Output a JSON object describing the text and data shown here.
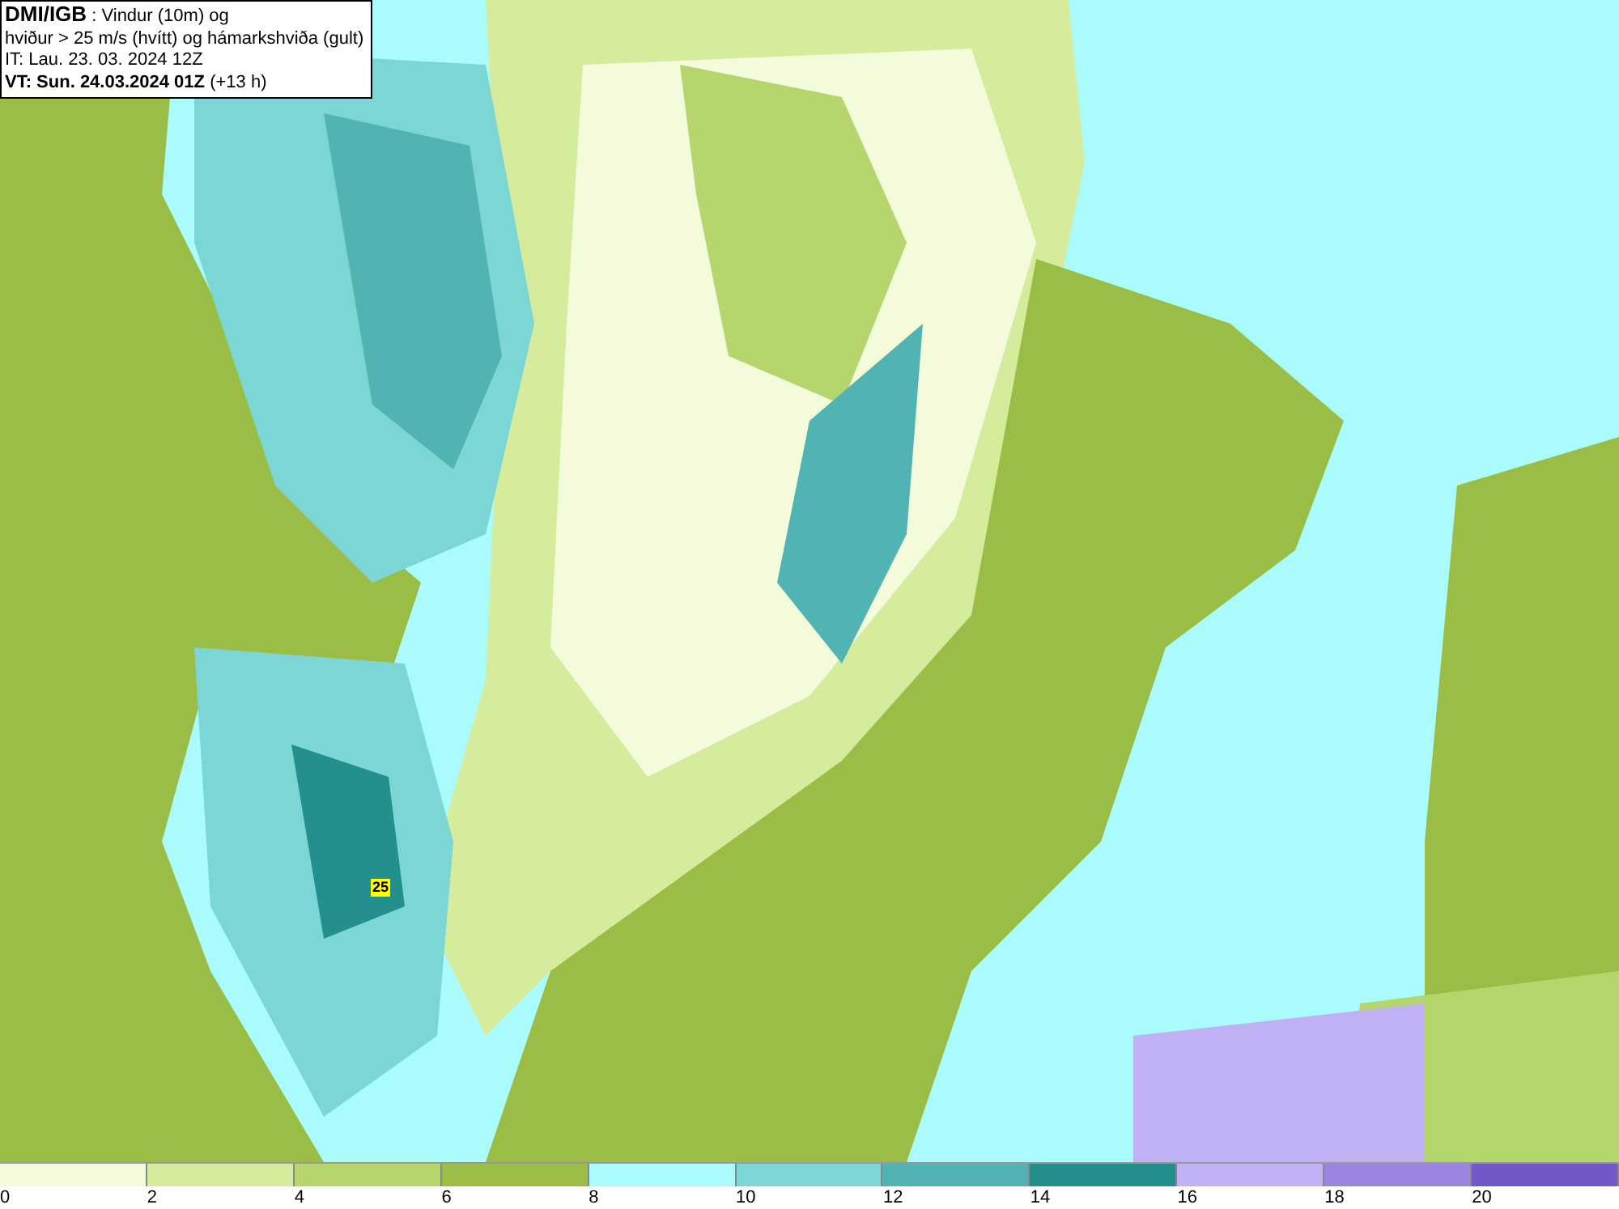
{
  "title_box": {
    "lines": [
      "**DMI/IGB** : Vindur (10m) og",
      "hviður > 25 m/s (hvítt) og hámarkshviða (gult)",
      "IT: Lau. 23. 03. 2024 12Z",
      "**VT: Sun. 24.03.2024 01Z** (+13 h)"
    ]
  },
  "map": {
    "gust_label": "25"
  },
  "legend": {
    "segments": [
      {
        "color": "#f3fbdb"
      },
      {
        "color": "#d4ec9c"
      },
      {
        "color": "#b5d66c"
      },
      {
        "color": "#9abe45"
      },
      {
        "color": "#aafcfc"
      },
      {
        "color": "#7dd6d6"
      },
      {
        "color": "#52b3b3"
      },
      {
        "color": "#23908e"
      },
      {
        "color": "#c0b0f4"
      },
      {
        "color": "#9c84e0"
      },
      {
        "color": "#7458c8"
      }
    ],
    "ticks": [
      "0",
      "2",
      "4",
      "6",
      "8",
      "10",
      "12",
      "14",
      "16",
      "18",
      "20"
    ]
  }
}
